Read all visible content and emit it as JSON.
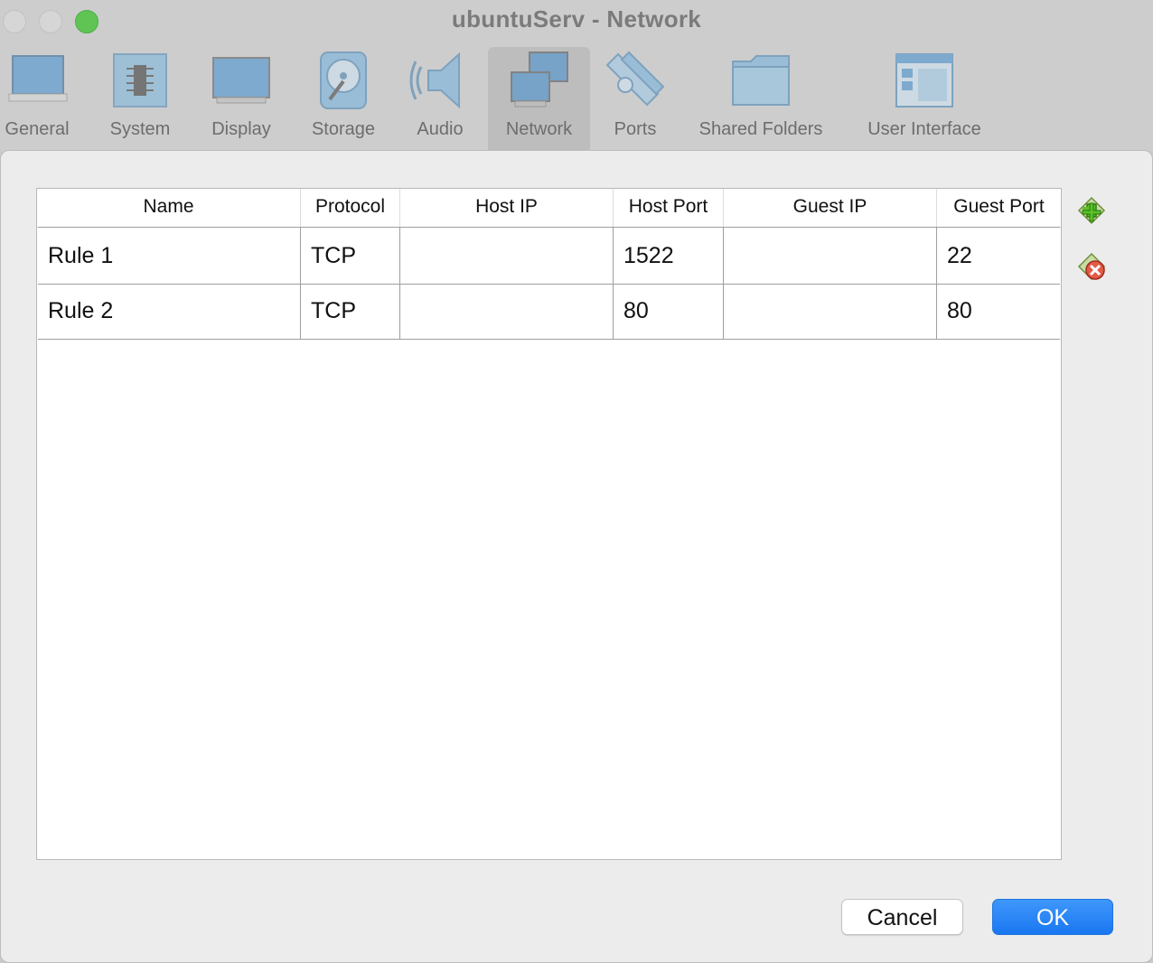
{
  "window": {
    "title": "ubuntuServ - Network"
  },
  "toolbar": {
    "tabs": [
      {
        "label": "General",
        "icon": "general-icon"
      },
      {
        "label": "System",
        "icon": "system-chip-icon"
      },
      {
        "label": "Display",
        "icon": "display-monitor-icon"
      },
      {
        "label": "Storage",
        "icon": "storage-disk-icon"
      },
      {
        "label": "Audio",
        "icon": "audio-speaker-icon"
      },
      {
        "label": "Network",
        "icon": "network-icon",
        "active": true
      },
      {
        "label": "Ports",
        "icon": "ports-icon"
      },
      {
        "label": "Shared Folders",
        "icon": "shared-folders-icon"
      },
      {
        "label": "User Interface",
        "icon": "user-interface-icon"
      }
    ]
  },
  "table": {
    "headers": [
      "Name",
      "Protocol",
      "Host IP",
      "Host Port",
      "Guest IP",
      "Guest Port"
    ],
    "rows": [
      [
        "Rule 1",
        "TCP",
        "",
        "1522",
        "",
        "22"
      ],
      [
        "Rule 2",
        "TCP",
        "",
        "80",
        "",
        "80"
      ]
    ]
  },
  "side_actions": [
    {
      "name": "add-rule",
      "icon": "add-rule-icon",
      "color": "#4caf2a"
    },
    {
      "name": "remove-rule",
      "icon": "remove-rule-icon",
      "color": "#e0483a"
    }
  ],
  "buttons": {
    "cancel": "Cancel",
    "ok": "OK"
  },
  "colors": {
    "accent": "#1a77f1",
    "titlebar": "#cdcdcd",
    "sheet": "#ececec"
  }
}
